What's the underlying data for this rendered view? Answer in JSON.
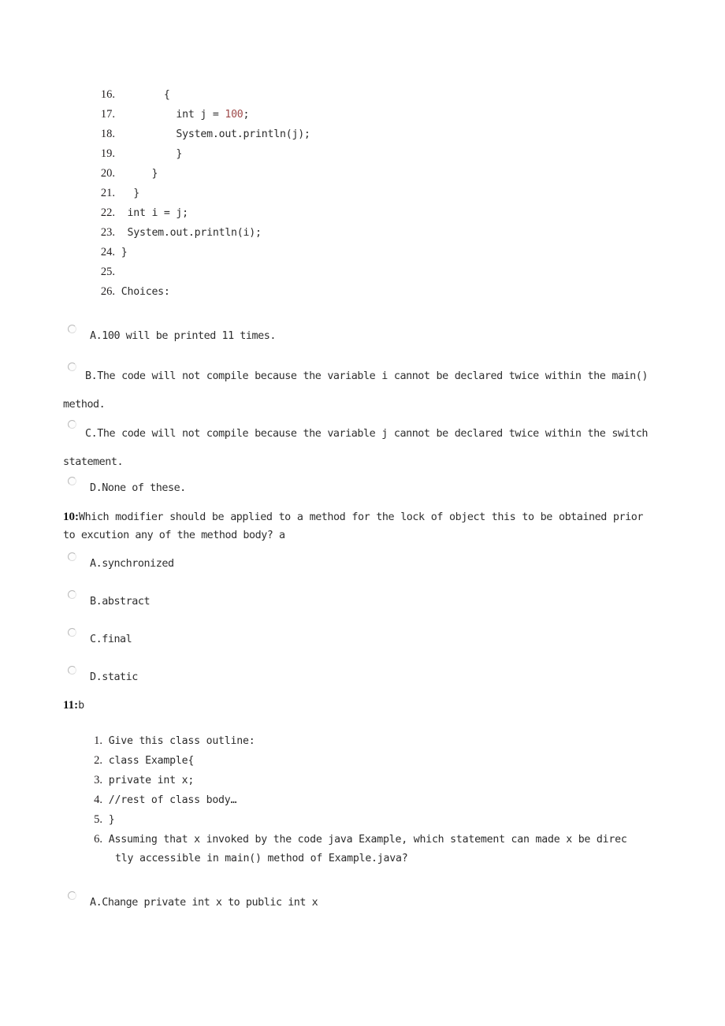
{
  "document": {
    "type": "java-quiz-page",
    "accent_number_color": "#9f4a4a",
    "text_color": "#2e2e2e"
  },
  "listing_top": {
    "lines": [
      {
        "no": "16.",
        "indent": "        ",
        "code": "{"
      },
      {
        "no": "17.",
        "indent": "          ",
        "code": "int j = ",
        "num": "100",
        "after": ";"
      },
      {
        "no": "18.",
        "indent": "          ",
        "code": "System.out.println(j);"
      },
      {
        "no": "19.",
        "indent": "          ",
        "code": "}"
      },
      {
        "no": "20.",
        "indent": "      ",
        "code": "}"
      },
      {
        "no": "21.",
        "indent": "   ",
        "code": "}"
      },
      {
        "no": "22.",
        "indent": "  ",
        "code": "int i = j;"
      },
      {
        "no": "23.",
        "indent": "  ",
        "code": "System.out.println(i);"
      },
      {
        "no": "24.",
        "indent": " ",
        "code": "}"
      },
      {
        "no": "25.",
        "indent": "",
        "code": ""
      },
      {
        "no": "26.",
        "indent": " ",
        "code": "Choices:"
      }
    ]
  },
  "question_9_options": [
    {
      "key": "A",
      "label": "A.100 will be printed 11 times."
    },
    {
      "key": "B",
      "label": "B.The code will not compile because the variable i cannot be declared twice within the main() method."
    },
    {
      "key": "C",
      "label": "C.The code will not compile because the variable j cannot be declared twice within the switch statement."
    },
    {
      "key": "D",
      "label": "D.None of these."
    }
  ],
  "question_10": {
    "number": "10:",
    "prompt": "Which modifier should be applied to a method for the lock of object this to be obtained prior to excution any of the method body? a",
    "options": [
      {
        "key": "A",
        "label": "A.synchronized"
      },
      {
        "key": "B",
        "label": "B.abstract"
      },
      {
        "key": "C",
        "label": "C.final"
      },
      {
        "key": "D",
        "label": "D.static"
      }
    ]
  },
  "question_11": {
    "number": "11:",
    "answer": "b",
    "listing": [
      {
        "no": "1.",
        "code": "Give this class outline:"
      },
      {
        "no": "2.",
        "code": "class Example{"
      },
      {
        "no": "3.",
        "code": "private int x;"
      },
      {
        "no": "4.",
        "code": "//rest of class body…"
      },
      {
        "no": "5.",
        "code": "}"
      },
      {
        "no": "6.",
        "code": "Assuming that x invoked by the code java Example, which statement can made x be direc",
        "cont": "tly accessible in main() method of Example.java?"
      }
    ],
    "options": [
      {
        "key": "A",
        "label": "A.Change private int x to public int x"
      }
    ]
  }
}
